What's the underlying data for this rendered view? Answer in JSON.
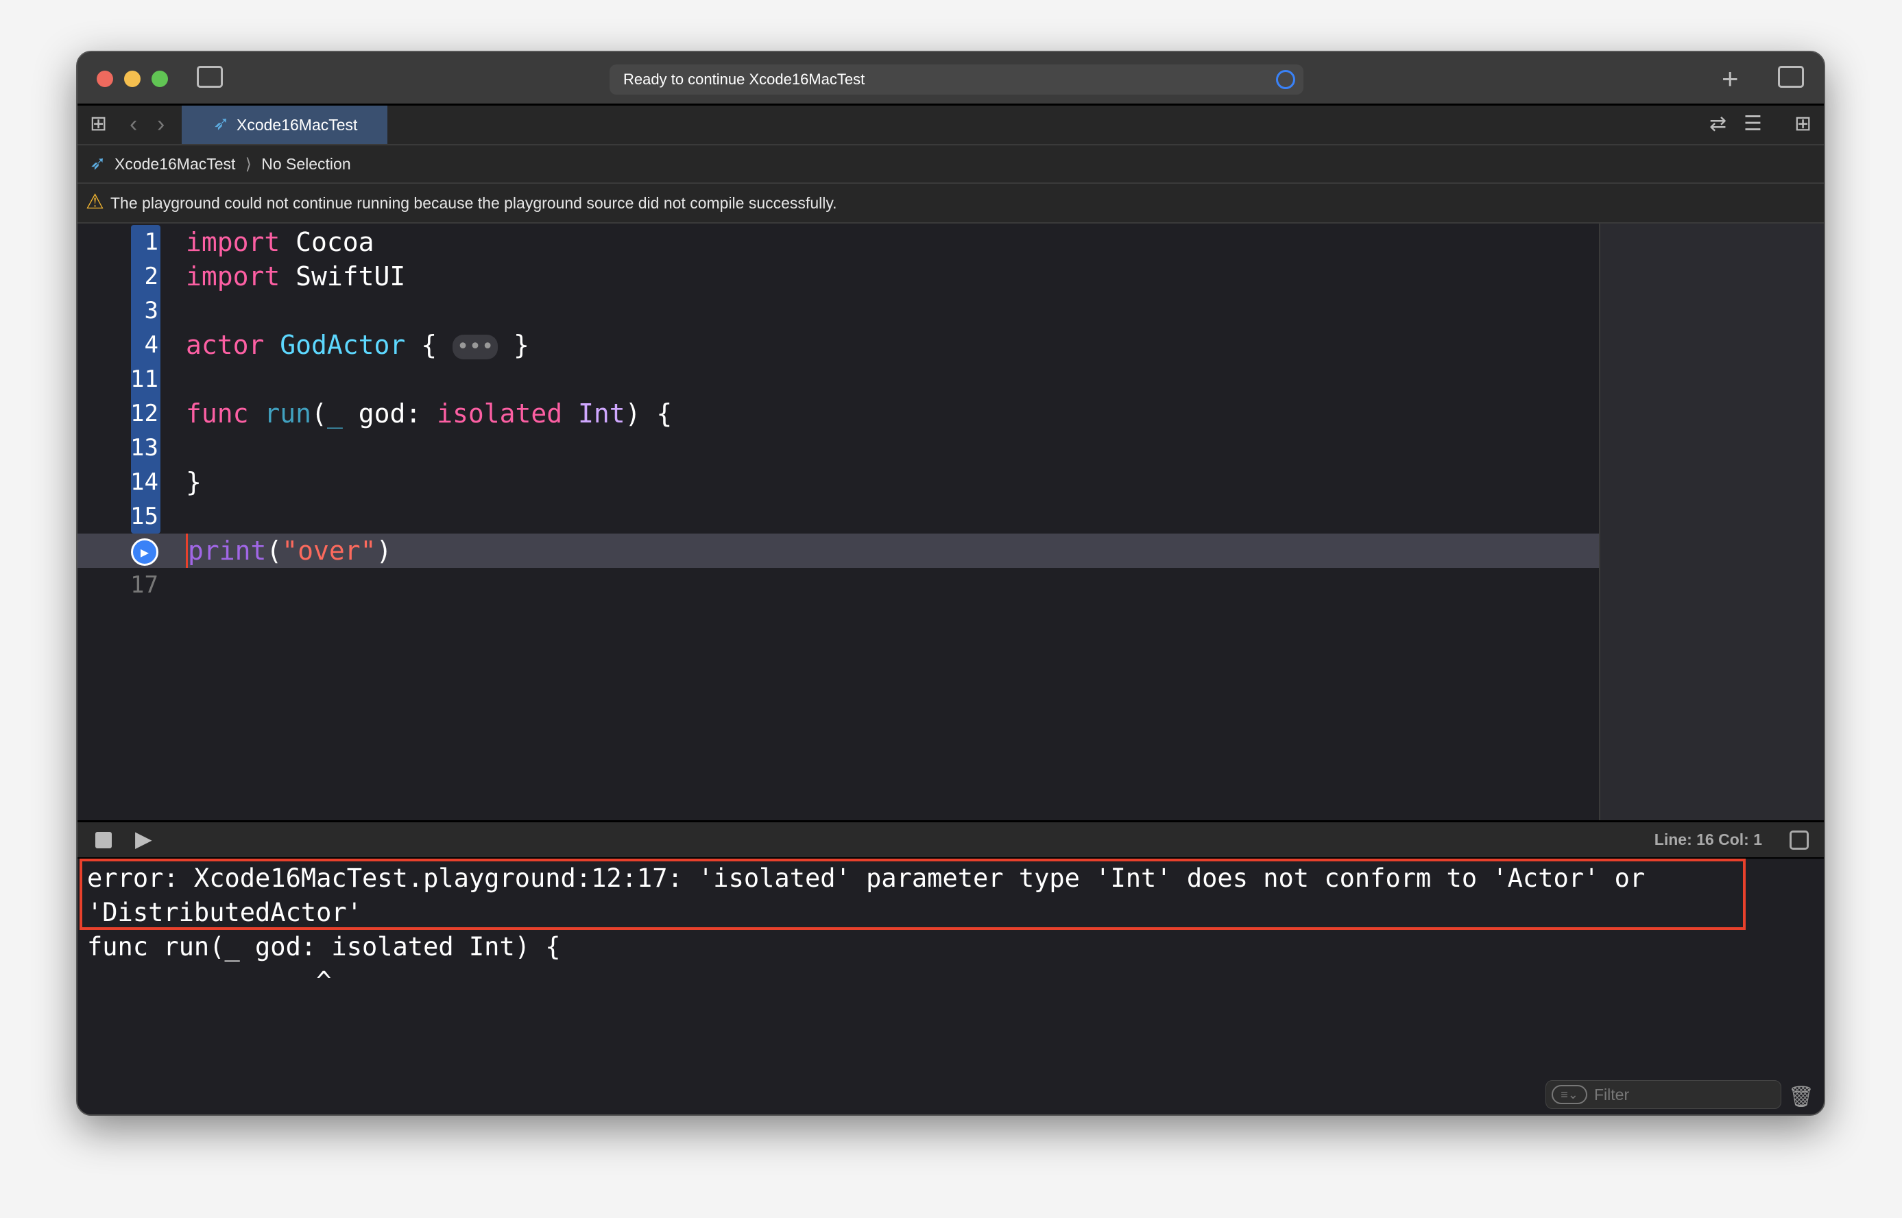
{
  "window": {
    "status_text": "Ready to continue Xcode16MacTest",
    "traffic_colors": [
      "#ee6a5e",
      "#f5bf4f",
      "#61c554"
    ]
  },
  "tab": {
    "label": "Xcode16MacTest"
  },
  "breadcrumb": {
    "project": "Xcode16MacTest",
    "separator": "⟩",
    "selection": "No Selection"
  },
  "warning": {
    "text": "The playground could not continue running because the playground source did not compile successfully."
  },
  "editor": {
    "lines": [
      {
        "n": "1",
        "tokens": [
          {
            "t": "import",
            "c": "kw"
          },
          {
            "t": " Cocoa",
            "c": ""
          }
        ]
      },
      {
        "n": "2",
        "tokens": [
          {
            "t": "import",
            "c": "kw"
          },
          {
            "t": " SwiftUI",
            "c": ""
          }
        ]
      },
      {
        "n": "3",
        "tokens": []
      },
      {
        "n": "4",
        "tokens": [
          {
            "t": "actor",
            "c": "kw"
          },
          {
            "t": " ",
            "c": ""
          },
          {
            "t": "GodActor",
            "c": "ty"
          },
          {
            "t": " { ",
            "c": ""
          },
          {
            "t": "•••",
            "c": "fold"
          },
          {
            "t": " }",
            "c": ""
          }
        ]
      },
      {
        "n": "11",
        "tokens": []
      },
      {
        "n": "12",
        "tokens": [
          {
            "t": "func",
            "c": "kw"
          },
          {
            "t": " ",
            "c": ""
          },
          {
            "t": "run",
            "c": "fn"
          },
          {
            "t": "(",
            "c": ""
          },
          {
            "t": "_",
            "c": "fn"
          },
          {
            "t": " god: ",
            "c": ""
          },
          {
            "t": "isolated",
            "c": "kw"
          },
          {
            "t": " ",
            "c": ""
          },
          {
            "t": "Int",
            "c": "ty2"
          },
          {
            "t": ") {",
            "c": ""
          }
        ]
      },
      {
        "n": "13",
        "tokens": []
      },
      {
        "n": "14",
        "tokens": [
          {
            "t": "}",
            "c": ""
          }
        ]
      },
      {
        "n": "15",
        "tokens": []
      },
      {
        "n": "",
        "current": true,
        "tokens": [
          {
            "t": "print",
            "c": "pr"
          },
          {
            "t": "(",
            "c": ""
          },
          {
            "t": "\"over\"",
            "c": "st"
          },
          {
            "t": ")",
            "c": ""
          }
        ]
      },
      {
        "n": "17",
        "dim": true,
        "tokens": []
      }
    ]
  },
  "statusbar": {
    "position": "Line: 16  Col: 1"
  },
  "console": {
    "error_line1": "error: Xcode16MacTest.playground:12:17: 'isolated' parameter type 'Int' does not conform to 'Actor' or",
    "error_line2": "'DistributedActor'",
    "source_line": "func run(_ god: isolated Int) {",
    "caret_line": "               ^",
    "filter_placeholder": "Filter"
  }
}
